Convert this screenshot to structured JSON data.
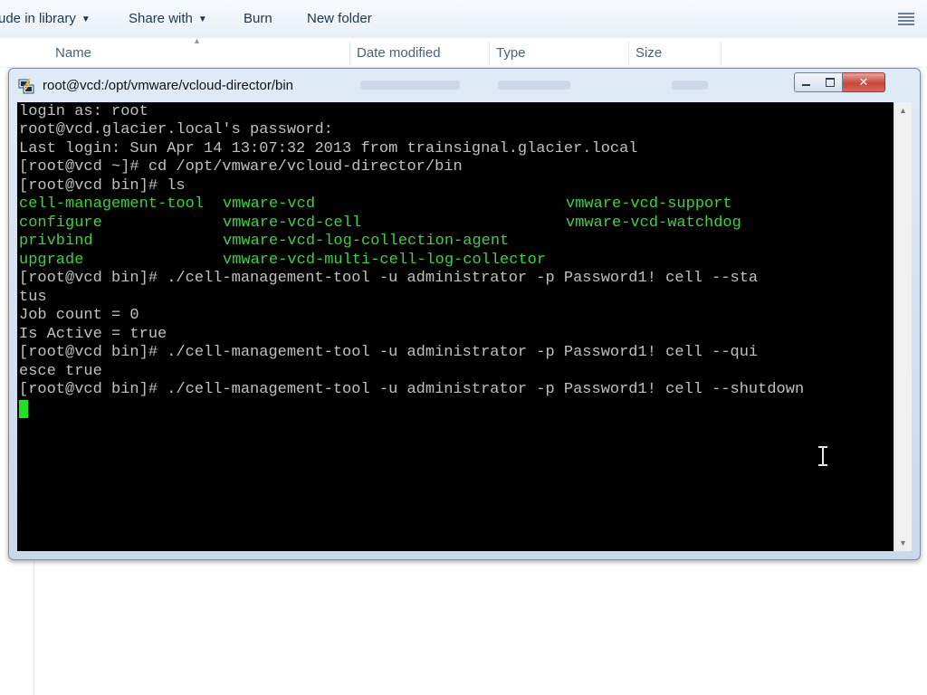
{
  "explorer": {
    "toolbar": {
      "include_in_library": "ude in library",
      "share_with": "Share with",
      "burn": "Burn",
      "new_folder": "New folder"
    },
    "columns": {
      "name": "Name",
      "date_modified": "Date modified",
      "type": "Type",
      "size": "Size"
    }
  },
  "terminal_window": {
    "title": "root@vcd:/opt/vmware/vcloud-director/bin",
    "close_glyph": "✕",
    "lines": [
      "login as: root",
      "root@vcd.glacier.local's password:",
      "Last login: Sun Apr 14 13:07:32 2013 from trainsignal.glacier.local",
      "[root@vcd ~]# cd /opt/vmware/vcloud-director/bin",
      "[root@vcd bin]# ls"
    ],
    "ls_output": [
      [
        "cell-management-tool",
        "vmware-vcd",
        "vmware-vcd-support"
      ],
      [
        "configure",
        "vmware-vcd-cell",
        "vmware-vcd-watchdog"
      ],
      [
        "privbind",
        "vmware-vcd-log-collection-agent",
        ""
      ],
      [
        "upgrade",
        "vmware-vcd-multi-cell-log-collector",
        ""
      ]
    ],
    "lines_after": [
      "[root@vcd bin]# ./cell-management-tool -u administrator -p Password1! cell --sta",
      "tus",
      "Job count = 0",
      "Is Active = true",
      "[root@vcd bin]# ./cell-management-tool -u administrator -p Password1! cell --qui",
      "esce true",
      "[root@vcd bin]# ./cell-management-tool -u administrator -p Password1! cell --shutdown"
    ],
    "colors": {
      "background": "#000000",
      "text": "#c0c0c0",
      "listing": "#3fd13f",
      "cursor": "#21e221"
    }
  },
  "icons": {
    "app": "putty-icon",
    "views": "view-options-icon",
    "text_cursor": "ibeam-cursor-icon"
  }
}
